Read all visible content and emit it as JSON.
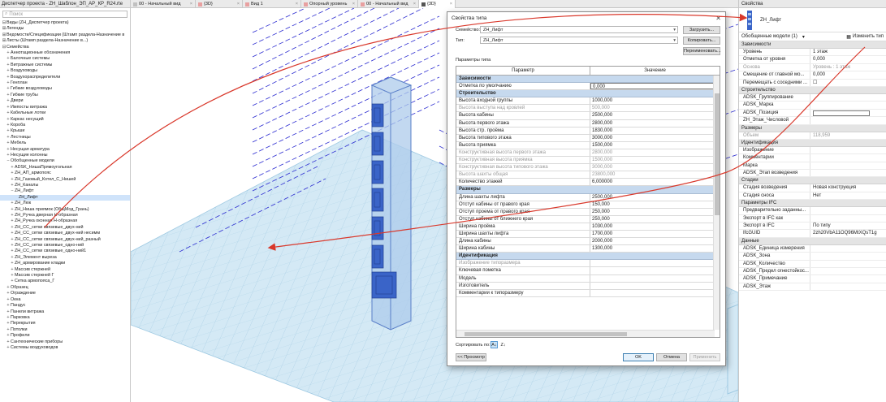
{
  "browser": {
    "title": "Диспетчер проекта - ZH_Шаблон_ЭП_АР_КР_R24.rte",
    "search_placeholder": "Поиск",
    "items": [
      {
        "t": "⊟",
        "label": "Виды (ZH_Диспетчер проекта)",
        "ind": 0
      },
      {
        "t": "⊞",
        "label": "Легенды",
        "ind": 0
      },
      {
        "t": "⊞",
        "label": "Ведомости/Спецификации (Штамп раздела-Назначение в",
        "ind": 0
      },
      {
        "t": "⊞",
        "label": "Листы (Штамп раздела-Назначение в...)",
        "ind": 0
      },
      {
        "t": "⊟",
        "label": "Семейства",
        "ind": 0
      },
      {
        "t": "+",
        "label": "Аннотационные обозначения",
        "ind": 1
      },
      {
        "t": "+",
        "label": "Балочные системы",
        "ind": 1
      },
      {
        "t": "+",
        "label": "Витражные системы",
        "ind": 1
      },
      {
        "t": "+",
        "label": "Воздуховоды",
        "ind": 1
      },
      {
        "t": "+",
        "label": "Воздухораспределители",
        "ind": 1
      },
      {
        "t": "+",
        "label": "Генплан",
        "ind": 1
      },
      {
        "t": "+",
        "label": "Гибкие воздуховоды",
        "ind": 1
      },
      {
        "t": "+",
        "label": "Гибкие трубы",
        "ind": 1
      },
      {
        "t": "+",
        "label": "Двери",
        "ind": 1
      },
      {
        "t": "+",
        "label": "Импосты витража",
        "ind": 1
      },
      {
        "t": "+",
        "label": "Кабельные лотки",
        "ind": 1
      },
      {
        "t": "+",
        "label": "Каркас несущий",
        "ind": 1
      },
      {
        "t": "+",
        "label": "Короба",
        "ind": 1
      },
      {
        "t": "+",
        "label": "Крыши",
        "ind": 1
      },
      {
        "t": "+",
        "label": "Лестницы",
        "ind": 1
      },
      {
        "t": "+",
        "label": "Мебель",
        "ind": 1
      },
      {
        "t": "+",
        "label": "Несущая арматура",
        "ind": 1
      },
      {
        "t": "+",
        "label": "Несущие колонны",
        "ind": 1
      },
      {
        "t": "−",
        "label": "Обобщенные модели",
        "ind": 1
      },
      {
        "t": "+",
        "label": "ADSK_НишаПрямоугольная",
        "ind": 2
      },
      {
        "t": "+",
        "label": "ZH_АП_армопояс",
        "ind": 2
      },
      {
        "t": "+",
        "label": "ZH_Газовый_Котел_С_Нишей",
        "ind": 2
      },
      {
        "t": "+",
        "label": "ZH_Каналы",
        "ind": 2
      },
      {
        "t": "−",
        "label": "ZH_Лифт",
        "ind": 2
      },
      {
        "t": "",
        "label": "ZH_Лифт",
        "ind": 3,
        "sel": true
      },
      {
        "t": "+",
        "label": "ZH_Люк",
        "ind": 2
      },
      {
        "t": "+",
        "label": "ZH_Ниша приямок (ОбщМод_Грань)",
        "ind": 2
      },
      {
        "t": "+",
        "label": "ZH_Ручка дверная Н-образная",
        "ind": 2
      },
      {
        "t": "+",
        "label": "ZH_Ручка оконная Н-образная",
        "ind": 2
      },
      {
        "t": "+",
        "label": "ZH_СС_сетки связевые_двух-ний",
        "ind": 2
      },
      {
        "t": "+",
        "label": "ZH_СС_сетки связевые_двух-ний несимм",
        "ind": 2
      },
      {
        "t": "+",
        "label": "ZH_СС_сетки связевые_двух-ний_разный",
        "ind": 2
      },
      {
        "t": "+",
        "label": "ZH_СС_сетки связевые_одно-ний",
        "ind": 2
      },
      {
        "t": "+",
        "label": "ZH_СС_сетки связевые_одно-ний1",
        "ind": 2
      },
      {
        "t": "+",
        "label": "ZH_Элемент выреза",
        "ind": 2
      },
      {
        "t": "+",
        "label": "ZH_армирование кладки",
        "ind": 2
      },
      {
        "t": "+",
        "label": "Массив стержней",
        "ind": 2
      },
      {
        "t": "+",
        "label": "Массив стержней Г",
        "ind": 2
      },
      {
        "t": "+",
        "label": "Сетка армопояса_Г",
        "ind": 2
      },
      {
        "t": "+",
        "label": "Образец",
        "ind": 1
      },
      {
        "t": "+",
        "label": "Ограждение",
        "ind": 1
      },
      {
        "t": "+",
        "label": "Окна",
        "ind": 1
      },
      {
        "t": "+",
        "label": "Пандус",
        "ind": 1
      },
      {
        "t": "+",
        "label": "Панели витража",
        "ind": 1
      },
      {
        "t": "+",
        "label": "Парковка",
        "ind": 1
      },
      {
        "t": "+",
        "label": "Перекрытия",
        "ind": 1
      },
      {
        "t": "+",
        "label": "Потолки",
        "ind": 1
      },
      {
        "t": "+",
        "label": "Профили",
        "ind": 1
      },
      {
        "t": "+",
        "label": "Сантехнические приборы",
        "ind": 1
      },
      {
        "t": "+",
        "label": "Системы воздуховодов",
        "ind": 1
      }
    ]
  },
  "tabs": [
    {
      "label": "00 - Начальный вид",
      "icon_color": "#c0c0c0",
      "w": 80
    },
    {
      "label": "{3D}",
      "icon_color": "#e8a0a0",
      "w": 58
    },
    {
      "label": "Вид 1",
      "icon_color": "#e8a0a0",
      "w": 72
    },
    {
      "label": "Опорный уровень",
      "icon_color": "#e8a0a0",
      "w": 70
    },
    {
      "label": "00 - Начальный вид",
      "icon_color": "#e8a0a0",
      "w": 75
    },
    {
      "label": "{3D}",
      "icon_color": "#555555",
      "w": 45,
      "active": true
    }
  ],
  "dialog": {
    "title": "Свойства типа",
    "family_label": "Семейство:",
    "family_value": "ZH_Лифт",
    "type_label": "Тип:",
    "type_value": "ZH_Лифт",
    "load_btn": "Загрузить...",
    "copy_btn": "Копировать...",
    "rename_btn": "Переименовать...",
    "params_label": "Параметры типа",
    "col_param": "Параметр",
    "col_value": "Значение",
    "rows": [
      {
        "s": "Зависимости"
      },
      {
        "k": "Отметка по умолчанию",
        "v": "0,000",
        "hl": true
      },
      {
        "s": "Строительство"
      },
      {
        "k": "Высота входной группы",
        "v": "1000,000"
      },
      {
        "k": "Высота выступа над кровлей",
        "v": "500,000",
        "dim": true
      },
      {
        "k": "Высота кабины",
        "v": "2500,000"
      },
      {
        "k": "Высота первого этажа",
        "v": "2800,000"
      },
      {
        "k": "Высота стр. проёма",
        "v": "1830,000"
      },
      {
        "k": "Высота типового этажа",
        "v": "3000,000"
      },
      {
        "k": "Высота приямка",
        "v": "1500,000"
      },
      {
        "k": "Конструктивная высота первого этажа",
        "v": "2800,000",
        "dim": true
      },
      {
        "k": "Конструктивная высота приямка",
        "v": "1500,000",
        "dim": true
      },
      {
        "k": "Конструктивная высота типового этажа",
        "v": "3000,000",
        "dim": true
      },
      {
        "k": "Высота шахты общая",
        "v": "23800,000",
        "dim": true
      },
      {
        "k": "Количество этажей",
        "v": "6,000000"
      },
      {
        "s": "Размеры"
      },
      {
        "k": "Длина шахты лифта",
        "v": "2500,000"
      },
      {
        "k": "Отступ кабины от правого края",
        "v": "150,000"
      },
      {
        "k": "Отступ проема от правого края",
        "v": "250,000"
      },
      {
        "k": "Отступ кабины от ближнего края",
        "v": "250,000"
      },
      {
        "k": "Ширина проёма",
        "v": "1030,000"
      },
      {
        "k": "Ширина шахты лифта",
        "v": "1700,000"
      },
      {
        "k": "Длина кабины",
        "v": "2000,000"
      },
      {
        "k": "Ширина кабины",
        "v": "1300,000"
      },
      {
        "s": "Идентификация"
      },
      {
        "k": "Изображение типоразмера",
        "v": "",
        "dim": true
      },
      {
        "k": "Ключевая пометка",
        "v": ""
      },
      {
        "k": "Модель",
        "v": ""
      },
      {
        "k": "Изготовитель",
        "v": ""
      },
      {
        "k": "Комментарии к типоразмеру",
        "v": ""
      }
    ],
    "sort_label": "Сортировать по:",
    "preview_btn": "<< Просмотр",
    "ok_btn": "OK",
    "cancel_btn": "Отмена",
    "apply_btn": "Применить"
  },
  "props": {
    "title": "Свойства",
    "type_name": "ZH_Лифт",
    "selector": "Обобщенные модели (1)",
    "edit_type": "Изменить тип",
    "groups": [
      {
        "name": "Зависимости",
        "rows": [
          {
            "k": "Уровень",
            "v": "1 этаж"
          },
          {
            "k": "Отметка от уровня",
            "v": "0,000"
          },
          {
            "k": "Основа",
            "v": "Уровень : 1 этаж",
            "dim": true
          },
          {
            "k": "Смещение от главной мо...",
            "v": "0,000"
          },
          {
            "k": "Перемещать с соседними ...",
            "v": "☐"
          }
        ]
      },
      {
        "name": "Строительство",
        "rows": [
          {
            "k": "ADSK_Группирование",
            "v": ""
          },
          {
            "k": "ADSK_Марка",
            "v": ""
          },
          {
            "k": "ADSK_Позиция",
            "v": "",
            "box": true
          },
          {
            "k": "ZH_Этаж_Числовой",
            "v": ""
          }
        ]
      },
      {
        "name": "Размеры",
        "rows": [
          {
            "k": "Объем",
            "v": "118,959",
            "dim": true
          }
        ]
      },
      {
        "name": "Идентификация",
        "rows": [
          {
            "k": "Изображение",
            "v": ""
          },
          {
            "k": "Комментарии",
            "v": ""
          },
          {
            "k": "Марка",
            "v": ""
          },
          {
            "k": "ADSK_Этап возведения",
            "v": ""
          }
        ]
      },
      {
        "name": "Стадии",
        "rows": [
          {
            "k": "Стадия возведения",
            "v": "Новая конструкция"
          },
          {
            "k": "Стадия сноса",
            "v": "Нет"
          }
        ]
      },
      {
        "name": "Параметры IFC",
        "rows": [
          {
            "k": "Предварительно заданны...",
            "v": ""
          },
          {
            "k": "Экспорт в IFC как",
            "v": ""
          },
          {
            "k": "Экспорт в IFC",
            "v": "По типу"
          },
          {
            "k": "IfcGUID",
            "v": "2zh20VbA11OQ96MtXQsT1g"
          }
        ]
      },
      {
        "name": "Данные",
        "rows": [
          {
            "k": "ADSK_Единица измерения",
            "v": ""
          },
          {
            "k": "ADSK_Зона",
            "v": ""
          },
          {
            "k": "ADSK_Количество",
            "v": ""
          },
          {
            "k": "ADSK_Предел огнестойкос...",
            "v": ""
          },
          {
            "k": "ADSK_Примечание",
            "v": ""
          },
          {
            "k": "ADSK_Этаж",
            "v": ""
          }
        ]
      }
    ]
  },
  "colors": {
    "annotation_arrow": "#d9382b",
    "floor_fill": "#cfe6f3",
    "floor_grid": "#9ec9e2",
    "lift": "#3a64c8",
    "grid_dash": "#2a2ad0"
  }
}
